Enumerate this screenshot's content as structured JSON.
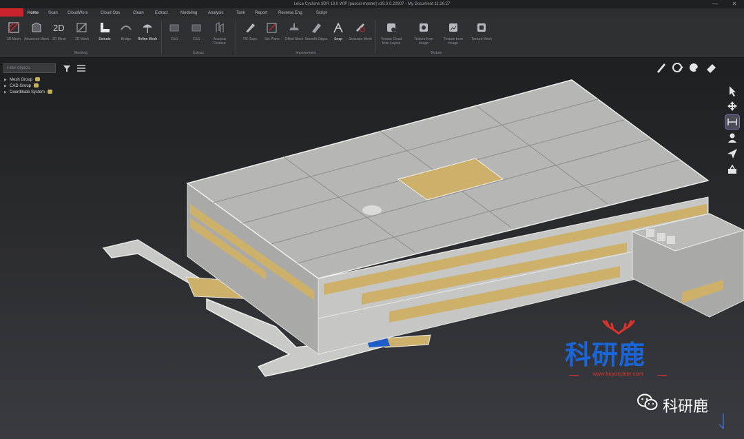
{
  "window": {
    "title": "Leica Cyclone 3DR 19.0 WIP [pascal-master] v19.0.0.22907 - My Document 11:26:27",
    "minimize": "—",
    "close": "✕"
  },
  "menubar": {
    "tabs": [
      "Home",
      "Scan",
      "CloudWorx",
      "Cloud Ops",
      "Clean",
      "Extract",
      "Modeling",
      "Analysis",
      "Tank",
      "Report",
      "Reverse Eng",
      "Script"
    ]
  },
  "ribbon": {
    "buttons": [
      {
        "label": "3D Mesh",
        "icon": "mesh-icon"
      },
      {
        "label": "Advanced Mesh",
        "icon": "advanced-mesh-icon"
      },
      {
        "label": "2D Mesh",
        "icon": "2d-mesh-icon",
        "text": "2D"
      },
      {
        "label": "2D Mesh",
        "icon": "2d-mesh-tool-icon"
      },
      {
        "label": "Extrude",
        "icon": "extrude-icon"
      },
      {
        "label": "Bridge",
        "icon": "bridge-icon"
      },
      {
        "label": "Refine Mesh",
        "icon": "refine-mesh-icon"
      },
      {
        "label": "CSG",
        "icon": "csg-icon"
      },
      {
        "label": "CSG",
        "icon": "csg-tool-icon"
      },
      {
        "label": "Analysis Contour",
        "icon": "analysis-contour-icon"
      },
      {
        "label": "Fill Gaps",
        "icon": "fill-gaps-icon"
      },
      {
        "label": "Set Plane",
        "icon": "set-plane-icon"
      },
      {
        "label": "Offset Mesh",
        "icon": "offset-mesh-icon"
      },
      {
        "label": "Smooth Edges",
        "icon": "smooth-edges-icon"
      },
      {
        "label": "Snap",
        "icon": "snap-icon"
      },
      {
        "label": "Separate Mesh",
        "icon": "separate-mesh-icon"
      },
      {
        "label": "Texture Cloud from Layout",
        "icon": "texture-cloud-icon"
      },
      {
        "label": "Texture from Image",
        "icon": "texture-from-image-icon"
      },
      {
        "label": "Texture from Image",
        "icon": "texture-image-icon"
      },
      {
        "label": "Texture Mesh",
        "icon": "texture-mesh-icon"
      }
    ],
    "groups": [
      "Meshing",
      "Extract",
      "Improvement",
      "Texture"
    ]
  },
  "tree": {
    "filter_placeholder": "Filter objects",
    "items": [
      "Mesh Group",
      "CAD Group",
      "Coordinate System"
    ]
  },
  "watermark": {
    "title": "科研鹿",
    "url": "www.keyondeer.com",
    "account": "科研鹿"
  },
  "colors": {
    "ribbon": "#2f3034",
    "accent_red": "#c9242c",
    "roof": "#b8b9b6",
    "facade_gold": "#cdb06a",
    "watermark_blue": "#1a66d8"
  }
}
